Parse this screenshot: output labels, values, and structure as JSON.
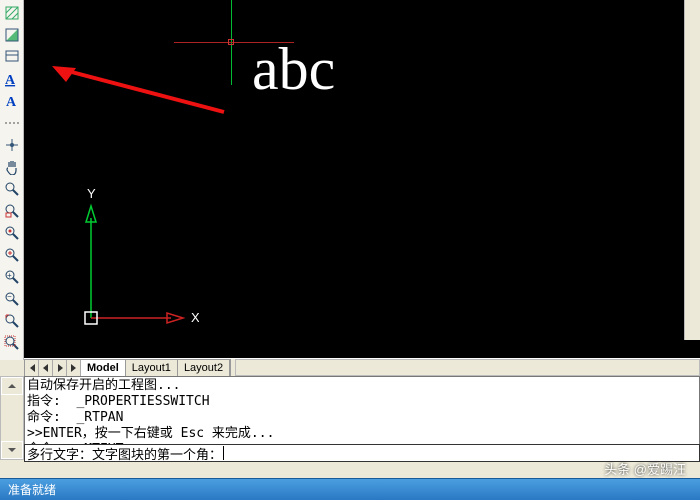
{
  "canvas": {
    "sample_text": "abc",
    "axis_y": "Y",
    "axis_x": "X"
  },
  "tabs": {
    "model": "Model",
    "layout1": "Layout1",
    "layout2": "Layout2"
  },
  "log": {
    "l1": "自动保存开启的工程图...",
    "l2": "指令:  _PROPERTIESSWITCH",
    "l3": "命令:  _RTPAN",
    "l4": ">>ENTER，按一下右键或 Esc 来完成...",
    "l5": "命令:  _MTEXT"
  },
  "cmd": {
    "prompt": "多行文字：文字图块的第一个角："
  },
  "watermark": "头条 @爱踢汪",
  "status": {
    "text": "准备就绪"
  }
}
